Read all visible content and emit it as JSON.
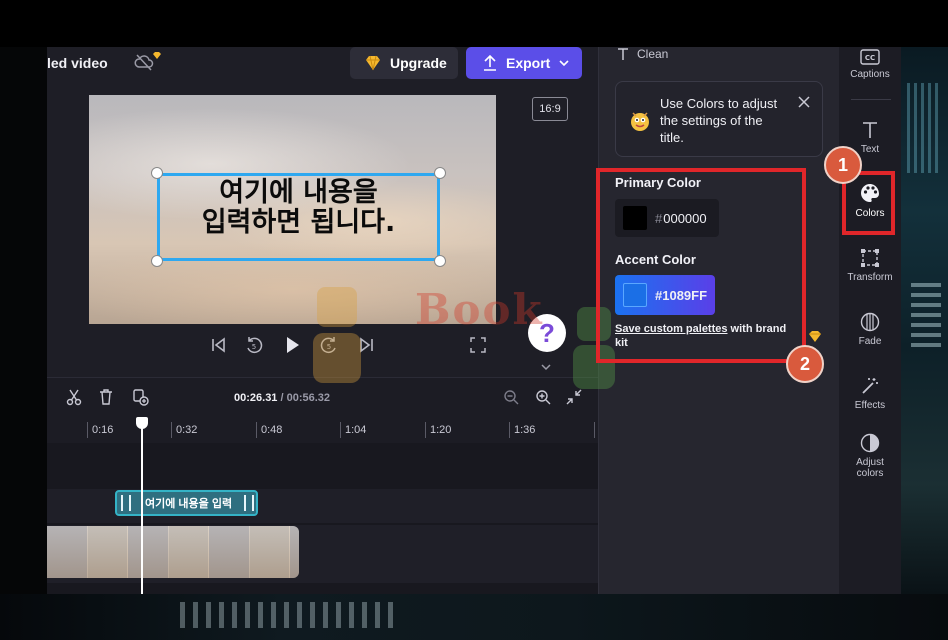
{
  "header": {
    "doc_title": "led video",
    "upgrade_label": "Upgrade",
    "export_label": "Export"
  },
  "preview": {
    "aspect_ratio": "16:9",
    "overlay_text_line1": "여기에 내용을",
    "overlay_text_line2": "입력하면 됩니다."
  },
  "timeline": {
    "current_time": "00:26.31",
    "total_time": "/ 00:56.32",
    "ticks": [
      "0:16",
      "0:32",
      "0:48",
      "1:04",
      "1:20",
      "1:36"
    ],
    "text_clip_label": "여기에 내용을 입력"
  },
  "panel": {
    "style_name": "Clean",
    "tip_text": "Use Colors to adjust the settings of the title.",
    "primary_label": "Primary Color",
    "primary_hex": "000000",
    "accent_label": "Accent Color",
    "accent_hex": "#1089FF",
    "palette_link": "Save custom palettes",
    "palette_suffix": " with brand kit"
  },
  "rail": {
    "items": [
      {
        "label": "Captions",
        "icon": "captions-icon"
      },
      {
        "label": "Text",
        "icon": "text-icon"
      },
      {
        "label": "Colors",
        "icon": "palette-icon"
      },
      {
        "label": "Transform",
        "icon": "transform-icon"
      },
      {
        "label": "Fade",
        "icon": "fade-icon"
      },
      {
        "label": "Effects",
        "icon": "effects-icon"
      },
      {
        "label": "Adjust colors",
        "icon": "adjust-colors-icon"
      }
    ]
  },
  "annotations": {
    "step1": "1",
    "step2": "2"
  },
  "watermark": {
    "text": "Book"
  },
  "colors": {
    "accent": "#1089FF",
    "export": "#5b4ee8",
    "highlight": "#e0262a"
  }
}
